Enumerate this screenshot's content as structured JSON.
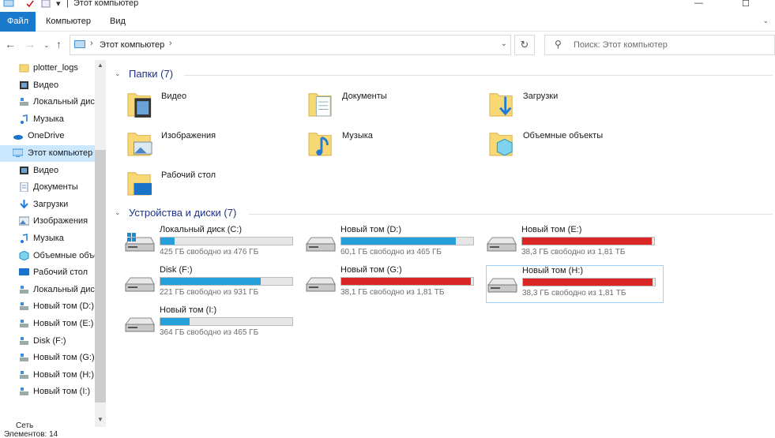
{
  "window": {
    "title": "Этот компьютер"
  },
  "ribbon": {
    "tabs": [
      "Файл",
      "Компьютер",
      "Вид"
    ]
  },
  "address": {
    "crumb": "Этот компьютер",
    "search_placeholder": "Поиск: Этот компьютер"
  },
  "navpane": {
    "items": [
      {
        "label": "plotter_logs",
        "icon": "folder-icon"
      },
      {
        "label": "Видео",
        "icon": "video-icon"
      },
      {
        "label": "Локальный дис",
        "icon": "drive-icon"
      },
      {
        "label": "Музыка",
        "icon": "music-icon"
      },
      {
        "label": "OneDrive",
        "icon": "onedrive-icon"
      },
      {
        "label": "Этот компьютер",
        "icon": "computer-icon"
      },
      {
        "label": "Видео",
        "icon": "video-icon"
      },
      {
        "label": "Документы",
        "icon": "documents-icon"
      },
      {
        "label": "Загрузки",
        "icon": "downloads-icon"
      },
      {
        "label": "Изображения",
        "icon": "pictures-icon"
      },
      {
        "label": "Музыка",
        "icon": "music-icon"
      },
      {
        "label": "Объемные объе",
        "icon": "3d-objects-icon"
      },
      {
        "label": "Рабочий стол",
        "icon": "desktop-icon"
      },
      {
        "label": "Локальный дис",
        "icon": "drive-icon"
      },
      {
        "label": "Новый том (D:)",
        "icon": "drive-icon"
      },
      {
        "label": "Новый том (E:)",
        "icon": "drive-icon"
      },
      {
        "label": "Disk (F:)",
        "icon": "drive-icon"
      },
      {
        "label": "Новый том (G:)",
        "icon": "drive-icon"
      },
      {
        "label": "Новый том (H:)",
        "icon": "drive-icon"
      },
      {
        "label": "Новый том (I:)",
        "icon": "drive-icon"
      }
    ]
  },
  "folders": {
    "header": "Папки (7)",
    "items": [
      {
        "name": "Видео",
        "icon": "video-folder-icon"
      },
      {
        "name": "Документы",
        "icon": "documents-folder-icon"
      },
      {
        "name": "Загрузки",
        "icon": "downloads-folder-icon"
      },
      {
        "name": "Изображения",
        "icon": "pictures-folder-icon"
      },
      {
        "name": "Музыка",
        "icon": "music-folder-icon"
      },
      {
        "name": "Объемные объекты",
        "icon": "3d-objects-folder-icon"
      },
      {
        "name": "Рабочий стол",
        "icon": "desktop-folder-icon"
      }
    ]
  },
  "drives": {
    "header": "Устройства и диски (7)",
    "items": [
      {
        "name": "Локальный диск (C:)",
        "free": "425 ГБ свободно из 476 ГБ",
        "used_fraction": 0.11,
        "bar_color": "#26a0da",
        "system": true
      },
      {
        "name": "Новый том (D:)",
        "free": "60,1 ГБ свободно из 465 ГБ",
        "used_fraction": 0.87,
        "bar_color": "#26a0da",
        "system": false
      },
      {
        "name": "Новый том (E:)",
        "free": "38,3 ГБ свободно из 1,81 ТБ",
        "used_fraction": 0.98,
        "bar_color": "#da2626",
        "system": false
      },
      {
        "name": "Disk (F:)",
        "free": "221 ГБ свободно из 931 ГБ",
        "used_fraction": 0.76,
        "bar_color": "#26a0da",
        "system": false
      },
      {
        "name": "Новый том (G:)",
        "free": "38,1 ГБ свободно из 1,81 ТБ",
        "used_fraction": 0.98,
        "bar_color": "#da2626",
        "system": false
      },
      {
        "name": "Новый том (H:)",
        "free": "38,3 ГБ свободно из 1,81 ТБ",
        "used_fraction": 0.98,
        "bar_color": "#da2626",
        "system": false
      },
      {
        "name": "Новый том (I:)",
        "free": "364 ГБ свободно из 465 ГБ",
        "used_fraction": 0.22,
        "bar_color": "#26a0da",
        "system": false
      }
    ]
  },
  "status": {
    "items_count": "Элементов: 14",
    "network": "Сеть"
  },
  "colors": {
    "accent": "#1979ca",
    "selection": "#cce8ff",
    "group_header": "#1e3287",
    "bar_normal": "#26a0da",
    "bar_full": "#da2626"
  }
}
